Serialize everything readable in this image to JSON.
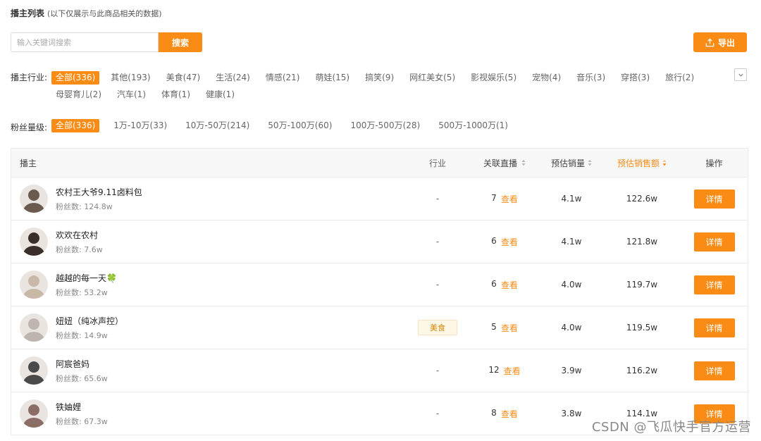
{
  "header": {
    "title": "播主列表",
    "subtitle": "(以下仅展示与此商品相关的数据)"
  },
  "search": {
    "placeholder": "输入关键词搜索",
    "value": "",
    "button_label": "搜索"
  },
  "export": {
    "label": "导出",
    "icon": "export-icon"
  },
  "filters": {
    "industry": {
      "label": "播主行业:",
      "rows": [
        [
          {
            "label": "全部(336)",
            "active": true
          },
          {
            "label": "其他(193)"
          },
          {
            "label": "美食(47)"
          },
          {
            "label": "生活(24)"
          },
          {
            "label": "情感(21)"
          },
          {
            "label": "萌娃(15)"
          },
          {
            "label": "搞笑(9)"
          },
          {
            "label": "网红美女(5)"
          },
          {
            "label": "影视娱乐(5)"
          },
          {
            "label": "宠物(4)"
          },
          {
            "label": "音乐(3)"
          },
          {
            "label": "穿搭(3)"
          },
          {
            "label": "旅行(2)"
          }
        ],
        [
          {
            "label": "母婴育儿(2)"
          },
          {
            "label": "汽车(1)"
          },
          {
            "label": "体育(1)"
          },
          {
            "label": "健康(1)"
          }
        ]
      ]
    },
    "fans": {
      "label": "粉丝量级:",
      "options": [
        {
          "label": "全部(336)",
          "active": true
        },
        {
          "label": "1万-10万(33)"
        },
        {
          "label": "10万-50万(214)"
        },
        {
          "label": "50万-100万(60)"
        },
        {
          "label": "100万-500万(28)"
        },
        {
          "label": "500万-1000万(1)"
        }
      ]
    }
  },
  "table": {
    "columns": {
      "streamer": "播主",
      "industry": "行业",
      "live": "关联直播",
      "volume": "预估销量",
      "sales": "预估销售额",
      "op": "操作"
    },
    "sorted_column": "sales",
    "rows": [
      {
        "name": "农村王大爷9.11卤料包",
        "fans": "粉丝数: 124.8w",
        "industry": "-",
        "live": "7",
        "view": "查看",
        "volume": "4.1w",
        "sales": "122.6w",
        "detail": "详情",
        "avatar_color": "#6b5a4e"
      },
      {
        "name": "欢欢在农村",
        "fans": "粉丝数: 7.6w",
        "industry": "-",
        "live": "6",
        "view": "查看",
        "volume": "4.1w",
        "sales": "121.8w",
        "detail": "详情",
        "avatar_color": "#3a2e2a"
      },
      {
        "name": "越越的每一天🍀",
        "fans": "粉丝数: 53.2w",
        "industry": "-",
        "live": "6",
        "view": "查看",
        "volume": "4.0w",
        "sales": "119.7w",
        "detail": "详情",
        "avatar_color": "#c9b7a8"
      },
      {
        "name": "妞妞（纯冰声控）",
        "fans": "粉丝数: 14.9w",
        "industry": "美食",
        "live": "5",
        "view": "查看",
        "volume": "4.0w",
        "sales": "119.5w",
        "detail": "详情",
        "avatar_color": "#bfb5b0"
      },
      {
        "name": "阿宸爸妈",
        "fans": "粉丝数: 65.6w",
        "industry": "-",
        "live": "12",
        "view": "查看",
        "volume": "3.9w",
        "sales": "116.2w",
        "detail": "详情",
        "avatar_color": "#4a4a4a"
      },
      {
        "name": "铁妯娌",
        "fans": "粉丝数: 67.3w",
        "industry": "-",
        "live": "8",
        "view": "查看",
        "volume": "3.8w",
        "sales": "114.1w",
        "detail": "详情",
        "avatar_color": "#8a6e66"
      }
    ]
  },
  "watermark": "CSDN @飞瓜快手官方运营"
}
